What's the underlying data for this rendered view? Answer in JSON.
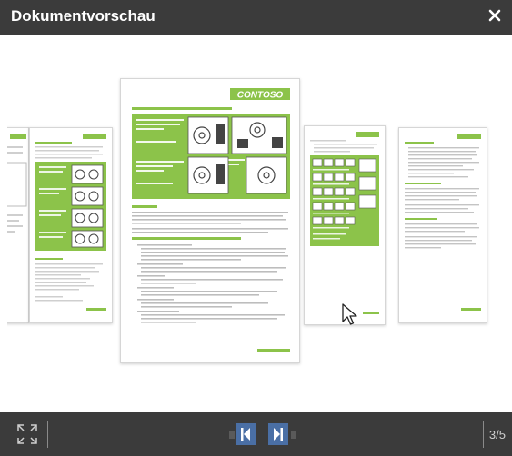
{
  "dialog": {
    "title": "Dokumentvorschau",
    "close_icon": "close-icon"
  },
  "preview": {
    "brand_logo_text": "CONTOSO",
    "pages": [
      {
        "name": "page-1"
      },
      {
        "name": "page-2"
      },
      {
        "name": "page-3"
      },
      {
        "name": "page-4"
      },
      {
        "name": "page-5"
      }
    ],
    "current_page": 3
  },
  "footer": {
    "fullscreen_icon": "fullscreen-icon",
    "prev_icon": "previous-page-icon",
    "next_icon": "next-page-icon",
    "page_counter": "3/5"
  },
  "colors": {
    "titlebar": "#3b3b3b",
    "accent_green": "#8cc34a",
    "nav_blue": "#4a6fa5"
  }
}
